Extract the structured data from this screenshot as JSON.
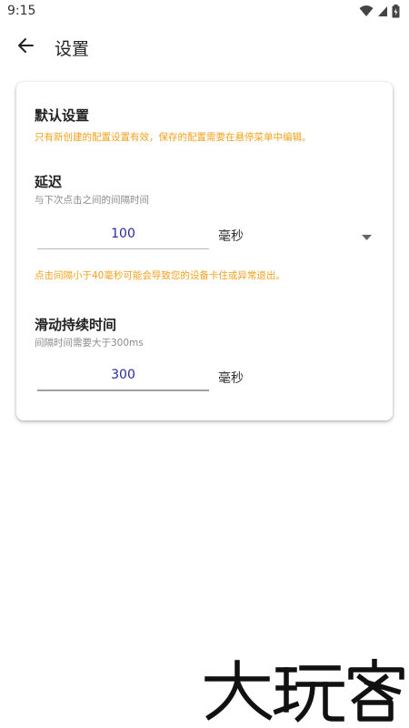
{
  "status_bar": {
    "time": "9:15",
    "icons": [
      "wifi-icon",
      "signal-icon",
      "battery-icon"
    ]
  },
  "app_bar": {
    "back_icon": "arrow-left-icon",
    "title": "设置"
  },
  "default_settings": {
    "title": "默认设置",
    "hint": "只有新创建的配置设置有效，保存的配置需要在悬停菜单中编辑。"
  },
  "delay": {
    "title": "延迟",
    "description": "与下次点击之间的间隔时间",
    "value": "100",
    "unit": "毫秒",
    "warning": "点击间隔小于40毫秒可能会导致您的设备卡住或异常退出。"
  },
  "swipe_duration": {
    "title": "滑动持续时间",
    "description": "间隔时间需要大于300ms",
    "value": "300",
    "unit": "毫秒"
  },
  "colors": {
    "accent_orange": "#f2a21c",
    "input_text": "#2b2a9c",
    "hint_gray": "#8a8a8a"
  },
  "watermark": {
    "text": "大玩客"
  }
}
